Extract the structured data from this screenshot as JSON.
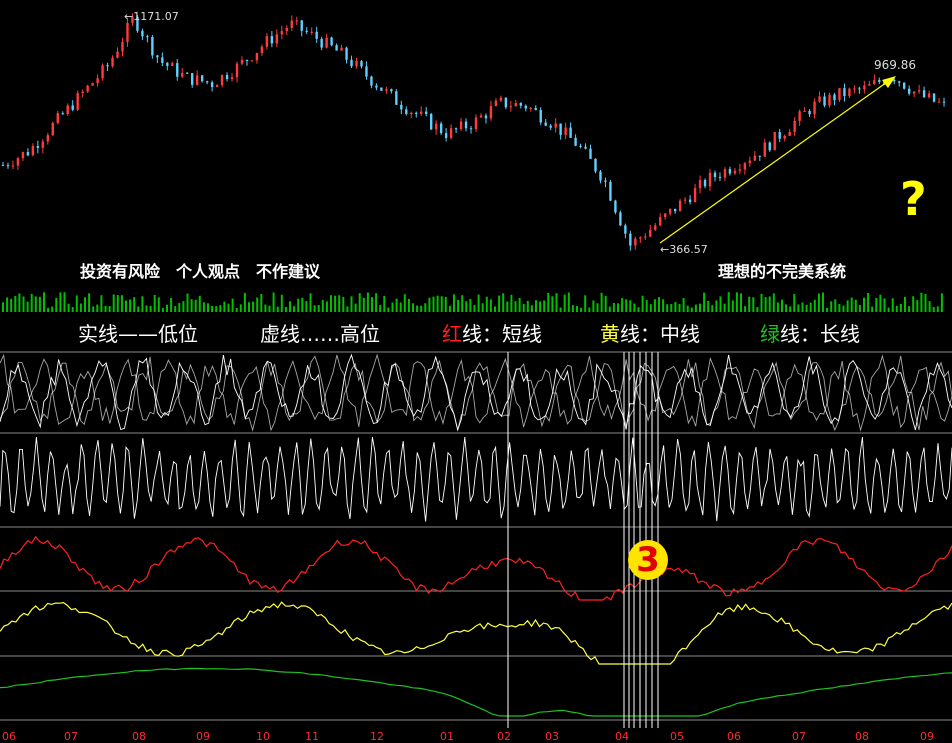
{
  "disclaimer": "投资有风险　个人观点　不作建议",
  "system_name": "理想的不完美系统",
  "legend": {
    "solid": "实线——低位",
    "dashed": "虚线……高位",
    "red_prefix": "红",
    "red_suffix": "线：短线",
    "yellow_prefix": "黄",
    "yellow_suffix": "线：中线",
    "green_prefix": "绿",
    "green_suffix": "线：长线"
  },
  "annotations": {
    "question": "?",
    "marker": "3"
  },
  "colors": {
    "background": "#000000",
    "candle_up": "#ff3b3b",
    "candle_down": "#5fd0ff",
    "volume": "#00c000",
    "short_line": "#ff2020",
    "mid_line": "#ffff40",
    "long_line": "#20c020",
    "oscillator": "#ffffff",
    "trend_arrow": "#ffff00",
    "tick_label": "#ff2a2a"
  },
  "chart_data": {
    "type": "line",
    "price": {
      "high_label": "1171.07",
      "low_label": "366.57",
      "peak_label": "969.86",
      "high": 1171.07,
      "low": 366.57,
      "recent_peak": 969.86,
      "approx_path": [
        650,
        700,
        800,
        900,
        1000,
        1171.07,
        1020,
        960,
        940,
        1000,
        1080,
        1150,
        1100,
        1040,
        960,
        880,
        820,
        760,
        800,
        870,
        860,
        800,
        720,
        600,
        366.57,
        440,
        520,
        600,
        650,
        700,
        780,
        860,
        900,
        920,
        969.86,
        900,
        860
      ]
    },
    "x_tick_labels": [
      "06",
      "07",
      "08",
      "09",
      "10",
      "11",
      "12",
      "01",
      "02",
      "03",
      "04",
      "05",
      "06",
      "07",
      "08",
      "09"
    ],
    "series": [
      {
        "name": "红线：短线"
      },
      {
        "name": "黄线：中线"
      },
      {
        "name": "绿线：长线"
      }
    ]
  }
}
